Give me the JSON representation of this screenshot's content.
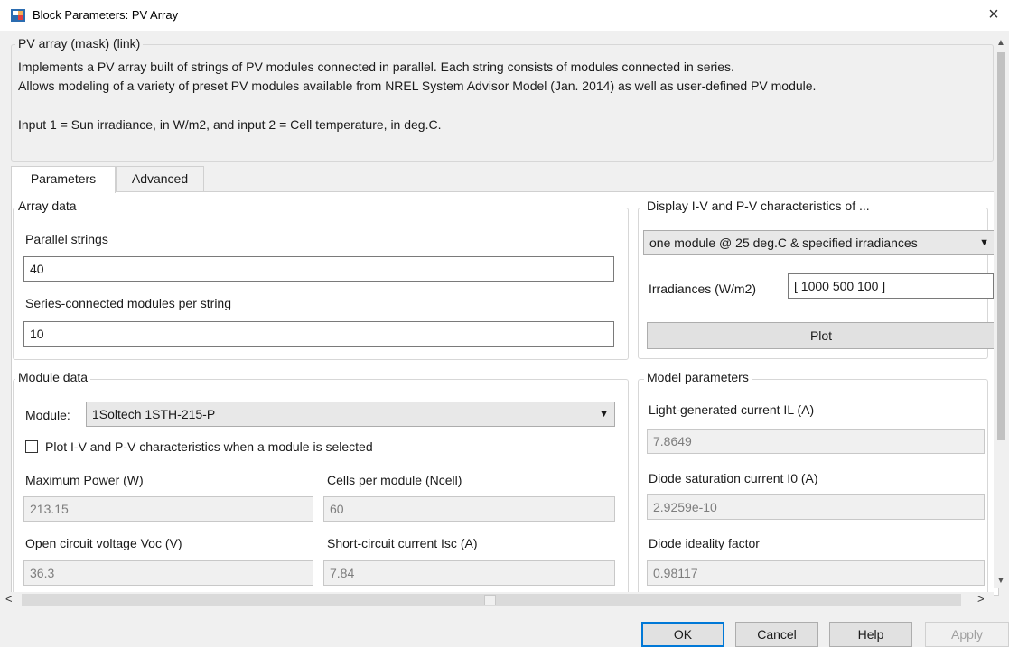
{
  "window": {
    "title": "Block Parameters: PV Array",
    "close_glyph": "×"
  },
  "mask": {
    "legend": "PV array (mask) (link)",
    "desc_line1": "Implements a PV array built of strings of PV modules connected in parallel. Each string consists of modules connected in series.",
    "desc_line2": "Allows modeling of a variety of preset PV modules available from NREL System Advisor Model (Jan. 2014) as well as user-defined PV module.",
    "desc_line3": "Input 1 = Sun irradiance, in W/m2, and input 2 = Cell temperature, in deg.C."
  },
  "tabs": {
    "parameters": "Parameters",
    "advanced": "Advanced",
    "active": "Parameters"
  },
  "array_data": {
    "legend": "Array data",
    "parallel_label": "Parallel strings",
    "parallel_value": "40",
    "series_label": "Series-connected modules per string",
    "series_value": "10"
  },
  "display": {
    "legend": "Display  I-V and P-V characteristics of ...",
    "selected": "one module @ 25 deg.C & specified irradiances",
    "irr_label": "Irradiances (W/m2)",
    "irr_value": "[ 1000  500  100 ]",
    "plot_label": "Plot"
  },
  "module_data": {
    "legend": "Module data",
    "module_label": "Module:",
    "module_value": "1Soltech 1STH-215-P",
    "checkbox_label": "Plot I-V and P-V characteristics when a module is selected",
    "checkbox_checked": false,
    "pmax_label": "Maximum Power (W)",
    "pmax_value": "213.15",
    "ncell_label": "Cells per module (Ncell)",
    "ncell_value": "60",
    "voc_label": "Open circuit voltage  Voc (V)",
    "voc_value": "36.3",
    "isc_label": "Short-circuit current Isc (A)",
    "isc_value": "7.84"
  },
  "model_params": {
    "legend": "Model parameters",
    "il_label": "Light-generated current IL (A)",
    "il_value": "7.8649",
    "i0_label": "Diode saturation current I0 (A)",
    "i0_value": "2.9259e-10",
    "ideality_label": "Diode ideality factor",
    "ideality_value": "0.98117"
  },
  "buttons": {
    "ok": "OK",
    "cancel": "Cancel",
    "help": "Help",
    "apply": "Apply"
  },
  "icons": {
    "app": "simulink-block-icon",
    "scroll_up": "▲",
    "scroll_down": "▼",
    "scroll_left": "<",
    "scroll_right": ">",
    "dropdown": "▼"
  },
  "colors": {
    "accent": "#0078d7",
    "readonly_text": "#7d7d7d"
  }
}
